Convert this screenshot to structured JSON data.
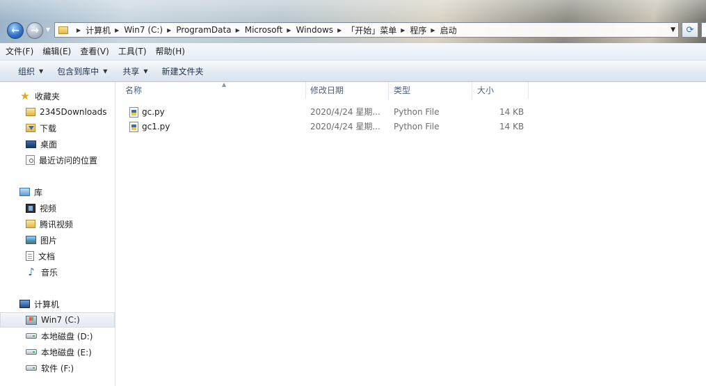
{
  "address": {
    "breadcrumbs": [
      "计算机",
      "Win7 (C:)",
      "ProgramData",
      "Microsoft",
      "Windows",
      "「开始」菜单",
      "程序",
      "启动"
    ]
  },
  "menu": [
    "文件(F)",
    "编辑(E)",
    "查看(V)",
    "工具(T)",
    "帮助(H)"
  ],
  "toolbar": {
    "organize": "组织",
    "include_in_library": "包含到库中",
    "share": "共享",
    "new_folder": "新建文件夹"
  },
  "nav": {
    "favorites": {
      "label": "收藏夹",
      "items": [
        "2345Downloads",
        "下载",
        "桌面",
        "最近访问的位置"
      ]
    },
    "libraries": {
      "label": "库",
      "items": [
        "视频",
        "腾讯视频",
        "图片",
        "文档",
        "音乐"
      ]
    },
    "computer": {
      "label": "计算机",
      "items": [
        "Win7 (C:)",
        "本地磁盘 (D:)",
        "本地磁盘 (E:)",
        "软件 (F:)"
      ]
    }
  },
  "columns": {
    "name": "名称",
    "date": "修改日期",
    "type": "类型",
    "size": "大小"
  },
  "files": [
    {
      "name": "gc.py",
      "date": "2020/4/24 星期...",
      "type": "Python File",
      "size": "14 KB"
    },
    {
      "name": "gc1.py",
      "date": "2020/4/24 星期...",
      "type": "Python File",
      "size": "14 KB"
    }
  ]
}
